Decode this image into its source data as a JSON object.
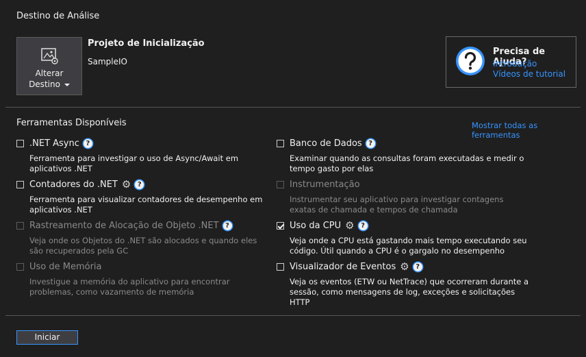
{
  "header": {
    "title": "Destino de Análise"
  },
  "target": {
    "change_button_line1": "Alterar",
    "change_button_line2": "Destino",
    "project_title": "Projeto de Inicialização",
    "project_name": "SampleIO"
  },
  "help": {
    "title": "Precisa de Ajuda?",
    "links": [
      "Introdução",
      "Vídeos de tutorial"
    ]
  },
  "tools": {
    "title": "Ferramentas Disponíveis",
    "show_all_link": "Mostrar todas as ferramentas",
    "items": [
      {
        "name": ".NET Async",
        "desc": "Ferramenta para investigar o uso de Async/Await em aplicativos .NET",
        "checked": false,
        "disabled": false,
        "gear": false
      },
      {
        "name": "Banco de Dados",
        "desc": "Examinar quando as consultas foram executadas e medir o tempo gasto por elas",
        "checked": false,
        "disabled": false,
        "gear": false
      },
      {
        "name": "Contadores do .NET",
        "desc": "Ferramenta para visualizar contadores de desempenho em aplicativos .NET",
        "checked": false,
        "disabled": false,
        "gear": true
      },
      {
        "name": "Instrumentação",
        "desc": "Instrumentar seu aplicativo para investigar contagens exatas de chamada e tempos de chamada",
        "checked": false,
        "disabled": true,
        "gear": false
      },
      {
        "name": "Rastreamento de Alocação de Objeto .NET",
        "desc": "Veja onde os Objetos do .NET são alocados e quando eles são recuperados pela GC",
        "checked": false,
        "disabled": true,
        "gear": false
      },
      {
        "name": "Uso da CPU",
        "desc": "Veja onde a CPU está gastando mais tempo executando seu código. Útil quando a CPU é o gargalo no desempenho",
        "checked": true,
        "disabled": false,
        "gear": true
      },
      {
        "name": "Uso de Memória",
        "desc": "Investigue a memória do aplicativo para encontrar problemas, como vazamento de memória",
        "checked": false,
        "disabled": true,
        "gear": false
      },
      {
        "name": "Visualizador de Eventos",
        "desc": "Veja os eventos (ETW ou NetTrace) que ocorreram durante a sessão, como mensagens de log, exceções e solicitações HTTP",
        "checked": false,
        "disabled": false,
        "gear": true
      }
    ]
  },
  "footer": {
    "start_label": "Iniciar"
  },
  "colors": {
    "background": "#1f1f1f",
    "accent": "#3794ff",
    "text": "#f1f1f1",
    "disabled_text": "#8a8a8a"
  }
}
